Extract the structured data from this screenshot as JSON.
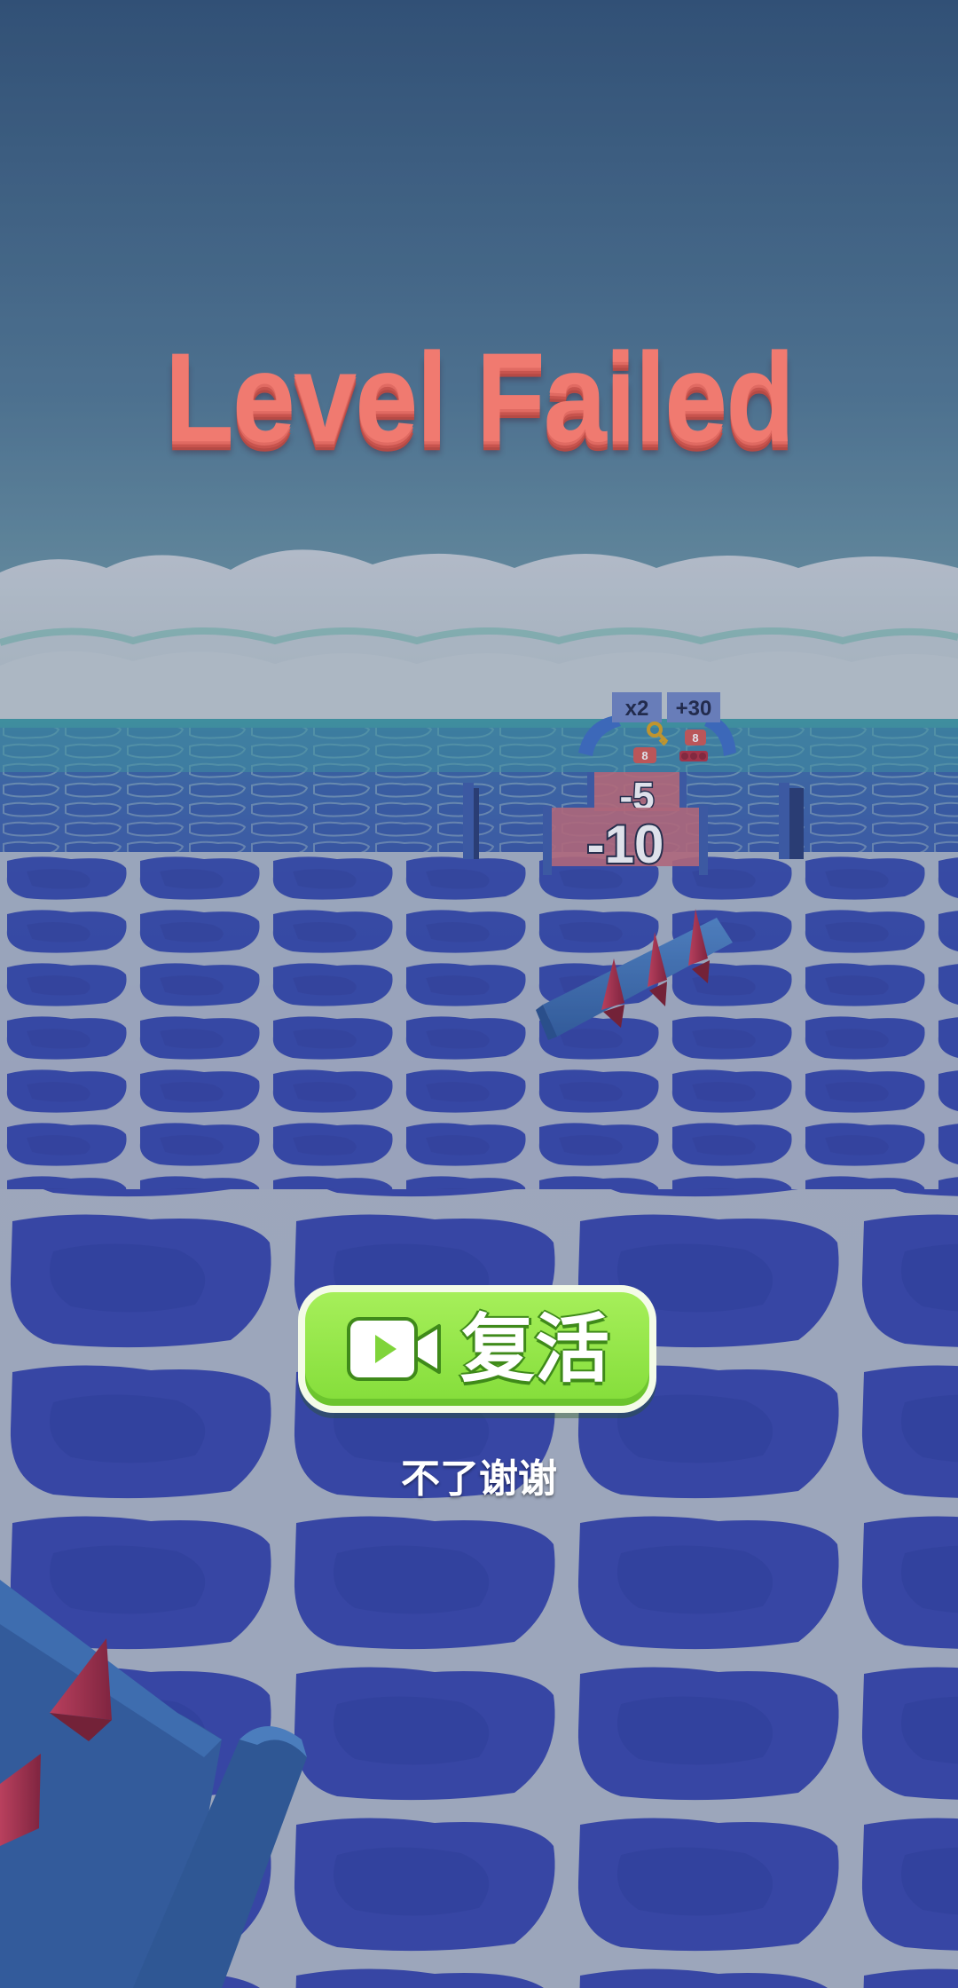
{
  "screen": {
    "title": "Level Failed",
    "revive_button": {
      "label": "复活",
      "icon": "video-camera-icon"
    },
    "skip_link": "不了谢谢"
  },
  "track": {
    "gate_labels": [
      "x2",
      "+30"
    ],
    "small_gate_values": [
      "8",
      "8",
      "8"
    ],
    "penalty_gates": [
      "-5",
      "-10"
    ]
  },
  "colors": {
    "sky_top": "#2e5172",
    "sky_horizon": "#5f8a9a",
    "water_cells": "#3745a8",
    "water_lines": "#b9c0c8",
    "title": "#f07a70",
    "button_green": "#8fe344",
    "spike_red": "#b1213a",
    "beam_blue": "#3a6fb8"
  }
}
